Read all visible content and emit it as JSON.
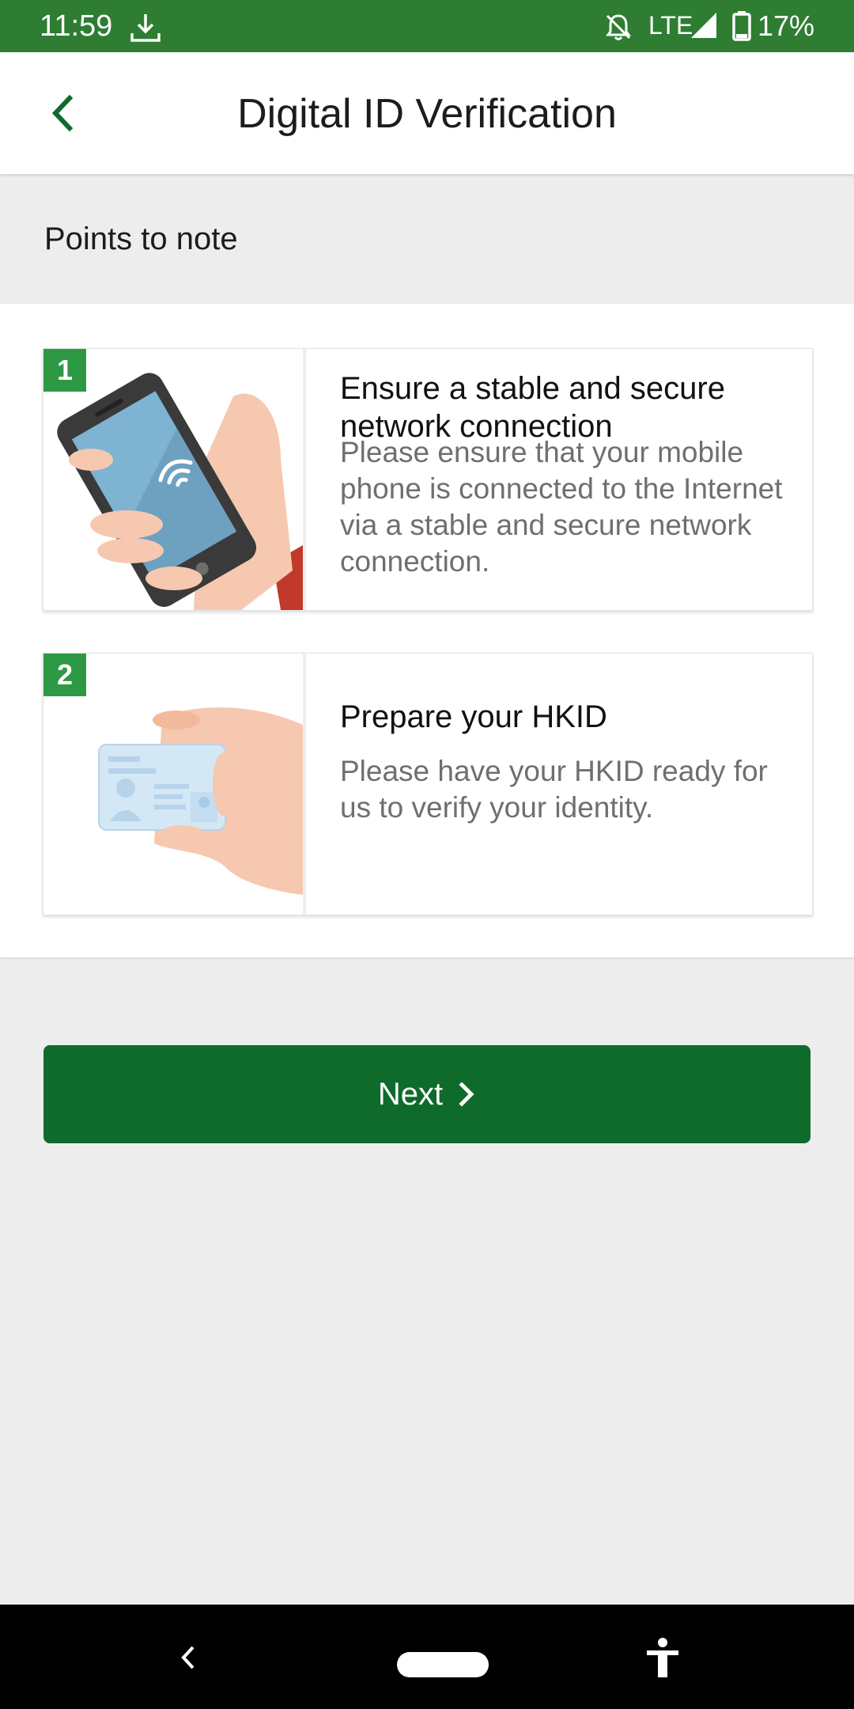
{
  "status_bar": {
    "time": "11:59",
    "network": "LTE",
    "battery": "17%",
    "icons": [
      "download-icon",
      "bell-off-icon",
      "signal-icon",
      "battery-icon"
    ]
  },
  "header": {
    "title": "Digital ID Verification",
    "back_icon": "chevron-left-icon"
  },
  "section_label": "Points to note",
  "cards": [
    {
      "number": "1",
      "illustration": "hand-holding-phone-wifi",
      "title": "Ensure a stable and secure network connection",
      "body": "Please ensure that your mobile phone is connected to the Internet via a stable and secure network connection."
    },
    {
      "number": "2",
      "illustration": "hand-holding-id-card",
      "title": "Prepare your HKID",
      "body": "Please have your HKID ready for us to verify your identity."
    }
  ],
  "next_button": {
    "label": "Next",
    "icon": "chevron-right-icon"
  },
  "nav_bar": {
    "icons": [
      "nav-back-icon",
      "nav-home-pill",
      "accessibility-icon"
    ]
  },
  "colors": {
    "status_bar": "#2e7d32",
    "accent_green": "#0e6b2b",
    "badge_green": "#2e9944",
    "background": "#ededed"
  }
}
